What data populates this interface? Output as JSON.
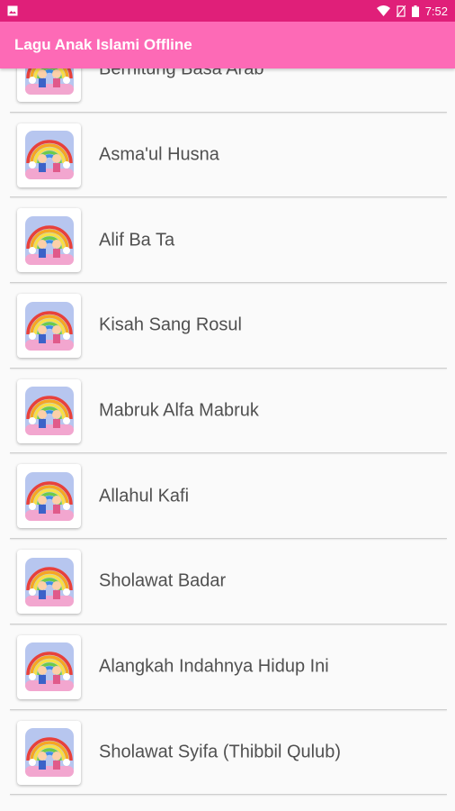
{
  "status_bar": {
    "time": "7:52",
    "icons": [
      "image-notification-icon",
      "wifi-icon",
      "no-sim-icon",
      "battery-icon"
    ]
  },
  "app_bar": {
    "title": "Lagu Anak Islami Offline"
  },
  "songs": [
    "Berhitung Basa Arab",
    "Asma'ul Husna",
    "Alif Ba Ta",
    "Kisah Sang Rosul",
    "Mabruk Alfa Mabruk",
    "Allahul Kafi",
    "Sholawat Badar",
    "Alangkah Indahnya Hidup Ini",
    "Sholawat Syifa (Thibbil Qulub)"
  ],
  "colors": {
    "status_bar": "#e01f79",
    "app_bar": "#fd6ab6",
    "background": "#fafafa",
    "label_text": "#505050"
  }
}
